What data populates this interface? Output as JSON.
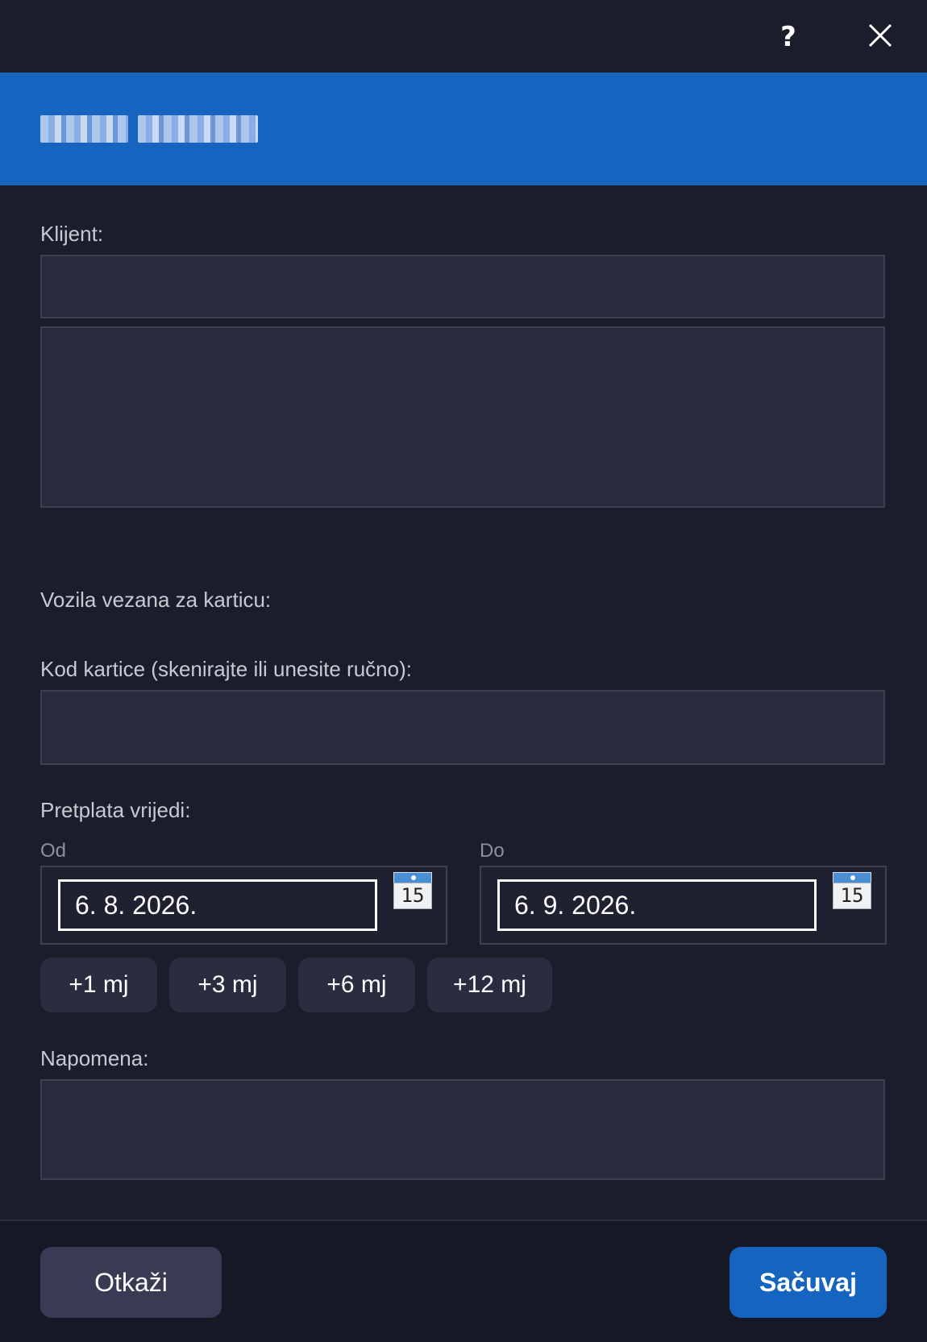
{
  "header": {
    "help_label": "?",
    "title_blurred": "Nova kartica"
  },
  "form": {
    "client_label": "Klijent:",
    "client_value": "",
    "client_details": "",
    "vehicles_label": "Vozila vezana za karticu:",
    "card_code_label": "Kod kartice (skenirajte ili unesite ručno):",
    "card_code_value": "",
    "subscription_label": "Pretplata vrijedi:",
    "from_label": "Od",
    "from_value": "6. 8. 2026.",
    "to_label": "Do",
    "to_value": "6. 9. 2026.",
    "calendar_day": "15",
    "quick_buttons": [
      "+1 mj",
      "+3 mj",
      "+6 mj",
      "+12 mj"
    ],
    "note_label": "Napomena:",
    "note_value": ""
  },
  "footer": {
    "cancel_label": "Otkaži",
    "save_label": "Sačuvaj"
  },
  "colors": {
    "background": "#1c1d2b",
    "accent": "#1565c0",
    "field": "#282a3d"
  }
}
